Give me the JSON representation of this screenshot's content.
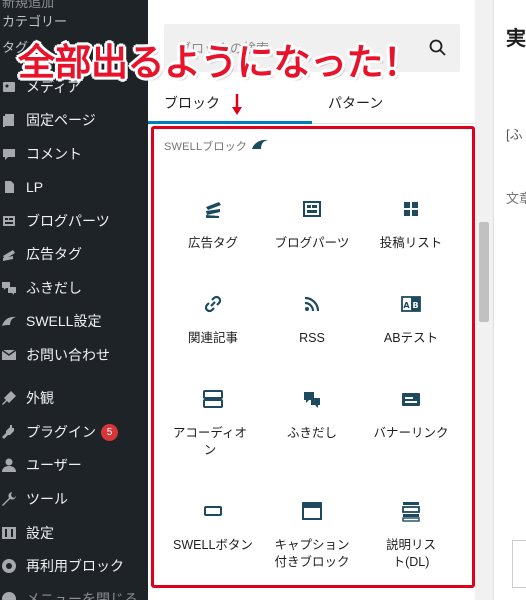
{
  "sidebar": {
    "partial_items": [
      "カテゴリー",
      "タグ"
    ],
    "items": [
      {
        "label": "メディア",
        "icon": "media-icon"
      },
      {
        "label": "固定ページ",
        "icon": "pages-icon"
      },
      {
        "label": "コメント",
        "icon": "comments-icon"
      },
      {
        "label": "LP",
        "icon": "lp-icon"
      },
      {
        "label": "ブログパーツ",
        "icon": "blog-parts-icon"
      },
      {
        "label": "広告タグ",
        "icon": "ad-tag-icon"
      },
      {
        "label": "ふきだし",
        "icon": "balloon-icon"
      },
      {
        "label": "SWELL設定",
        "icon": "swell-icon"
      },
      {
        "label": "お問い合わせ",
        "icon": "mail-icon"
      },
      {
        "label": "外観",
        "icon": "appearance-icon"
      },
      {
        "label": "プラグイン",
        "icon": "plugins-icon",
        "badge": "5"
      },
      {
        "label": "ユーザー",
        "icon": "users-icon"
      },
      {
        "label": "ツール",
        "icon": "tools-icon"
      },
      {
        "label": "設定",
        "icon": "settings-icon"
      },
      {
        "label": "再利用ブロック",
        "icon": "reusable-blocks-icon"
      }
    ]
  },
  "inserter": {
    "search_placeholder": "ブロックの検索",
    "tabs": [
      {
        "label": "ブロック",
        "active": true
      },
      {
        "label": "パターン",
        "active": false
      }
    ],
    "category_title": "SWELLブロック",
    "blocks": [
      {
        "label": "広告タグ",
        "icon": "ad-tag-icon"
      },
      {
        "label": "ブログパーツ",
        "icon": "blog-parts-icon"
      },
      {
        "label": "投稿リスト",
        "icon": "post-list-icon"
      },
      {
        "label": "関連記事",
        "icon": "related-post-icon"
      },
      {
        "label": "RSS",
        "icon": "rss-icon"
      },
      {
        "label": "ABテスト",
        "icon": "ab-test-icon"
      },
      {
        "label": "アコーディオン",
        "icon": "accordion-icon"
      },
      {
        "label": "ふきだし",
        "icon": "balloon-icon"
      },
      {
        "label": "バナーリンク",
        "icon": "banner-link-icon"
      },
      {
        "label": "SWELLボタン",
        "icon": "button-icon"
      },
      {
        "label": "キャプション付きブロック",
        "icon": "caption-block-icon"
      },
      {
        "label": "説明リスト(DL)",
        "icon": "dl-list-icon"
      }
    ]
  },
  "editor": {
    "heading_fragment": "実",
    "shortcode_fragment": "[ふ",
    "text_fragment": "文章"
  },
  "annotation": "全部出るようになった！",
  "colors": {
    "sidebar_bg": "#1d2327",
    "accent": "#007cba",
    "highlight_red": "#e0001b",
    "icon_dark": "#1d4a5e",
    "badge": "#d63638"
  }
}
